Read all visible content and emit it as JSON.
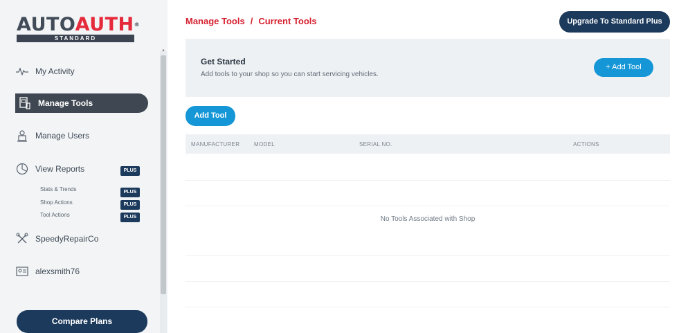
{
  "logo": {
    "part1": "AUTO",
    "part2": "AUTH",
    "reg": "®",
    "tier": "STANDARD"
  },
  "nav": {
    "my_activity": "My Activity",
    "manage_tools": "Manage Tools",
    "manage_users": "Manage Users",
    "view_reports": "View Reports",
    "shop": "SpeedyRepairCo",
    "user": "alexsmith76"
  },
  "badge": "PLUS",
  "reports_sub": [
    "Stats & Trends",
    "Shop Actions",
    "Tool Actions"
  ],
  "compare_label": "Compare Plans",
  "breadcrumb": {
    "parent": "Manage Tools",
    "sep": "/",
    "current": "Current Tools"
  },
  "upgrade_label": "Upgrade To Standard Plus",
  "get_started": {
    "title": "Get Started",
    "description": "Add tools to your shop so you can start servicing vehicles.",
    "button": "+ Add Tool"
  },
  "add_tool_label": "Add Tool",
  "table": {
    "columns": [
      "MANUFACTURER",
      "MODEL",
      "SERIAL NO.",
      "ACTIONS"
    ],
    "empty_message": "No Tools Associated with Shop"
  },
  "colors": {
    "navy": "#1c3a5c",
    "accent_blue": "#1596d6",
    "brand_red": "#e52a3b",
    "active_nav": "#3f4852"
  }
}
